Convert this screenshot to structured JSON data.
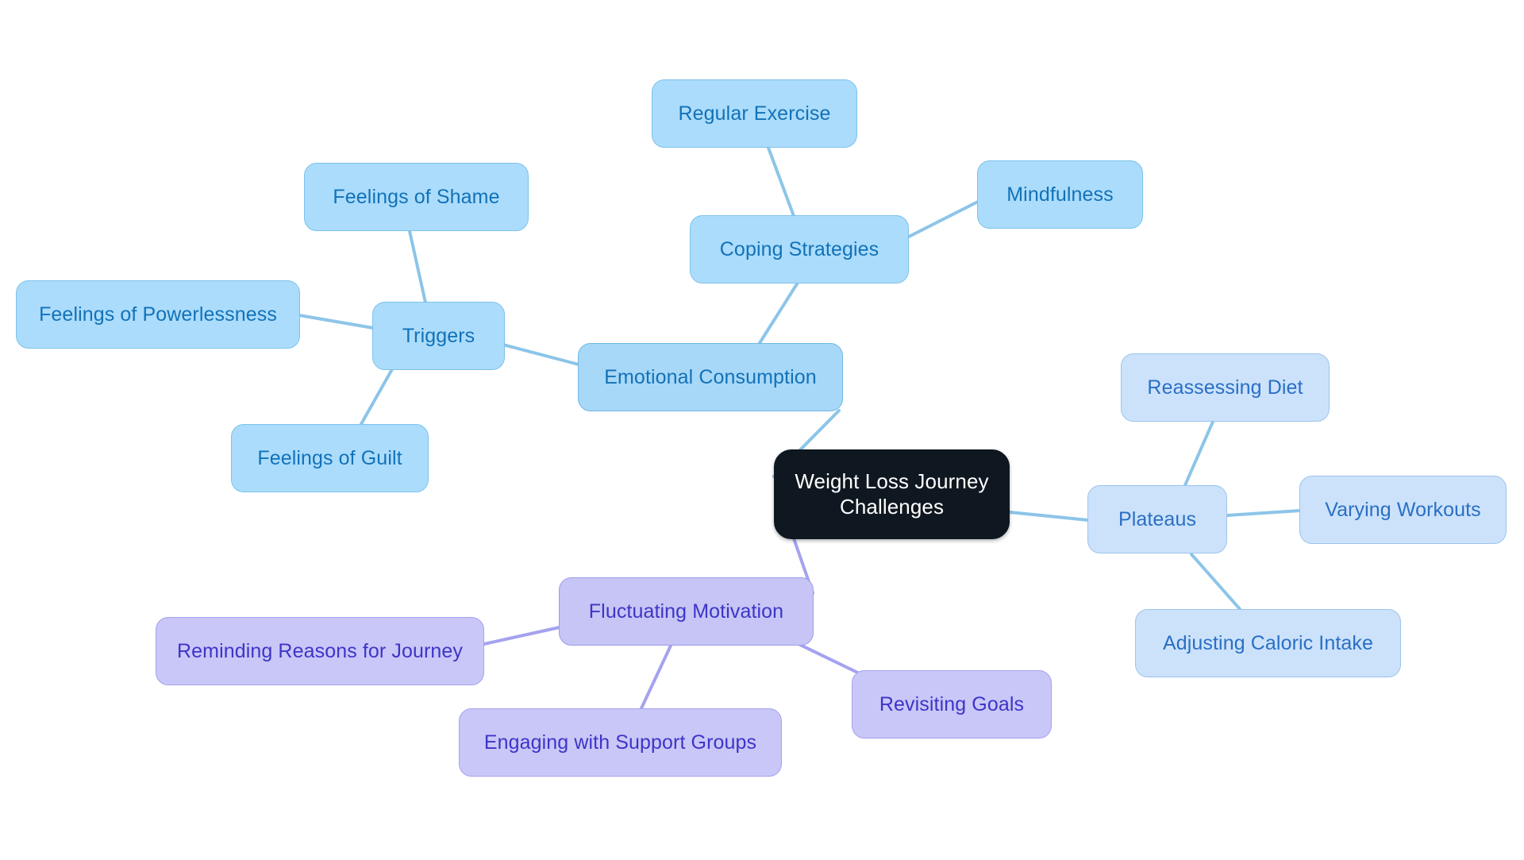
{
  "diagram": {
    "title": "Weight Loss Journey Challenges",
    "type": "mind-map",
    "background_color": "#ffffff",
    "edge_colors": {
      "blue": "#8cc5e8",
      "purple": "#a5a2ef"
    }
  },
  "nodes": {
    "root": {
      "label": "Weight Loss Journey\nChallenges"
    },
    "emotional_consumption": {
      "label": "Emotional Consumption"
    },
    "triggers": {
      "label": "Triggers"
    },
    "feelings_of_shame": {
      "label": "Feelings of Shame"
    },
    "feelings_of_powerlessness": {
      "label": "Feelings of Powerlessness"
    },
    "feelings_of_guilt": {
      "label": "Feelings of Guilt"
    },
    "coping_strategies": {
      "label": "Coping Strategies"
    },
    "regular_exercise": {
      "label": "Regular Exercise"
    },
    "mindfulness": {
      "label": "Mindfulness"
    },
    "plateaus": {
      "label": "Plateaus"
    },
    "reassessing_diet": {
      "label": "Reassessing Diet"
    },
    "varying_workouts": {
      "label": "Varying Workouts"
    },
    "adjusting_caloric_intake": {
      "label": "Adjusting Caloric Intake"
    },
    "fluctuating_motivation": {
      "label": "Fluctuating Motivation"
    },
    "reminding_reasons_for_journey": {
      "label": "Reminding Reasons for Journey"
    },
    "engaging_with_support_groups": {
      "label": "Engaging with Support Groups"
    },
    "revisiting_goals": {
      "label": "Revisiting Goals"
    }
  },
  "chart_data": {
    "type": "diagram",
    "title": "Weight Loss Journey Challenges",
    "root": "Weight Loss Journey Challenges",
    "branches": [
      {
        "name": "Emotional Consumption",
        "color": "#a8d8f8",
        "children": [
          {
            "name": "Triggers",
            "children": [
              {
                "name": "Feelings of Shame"
              },
              {
                "name": "Feelings of Powerlessness"
              },
              {
                "name": "Feelings of Guilt"
              }
            ]
          },
          {
            "name": "Coping Strategies",
            "children": [
              {
                "name": "Regular Exercise"
              },
              {
                "name": "Mindfulness"
              }
            ]
          }
        ]
      },
      {
        "name": "Plateaus",
        "color": "#cce2fb",
        "children": [
          {
            "name": "Reassessing Diet"
          },
          {
            "name": "Varying Workouts"
          },
          {
            "name": "Adjusting Caloric Intake"
          }
        ]
      },
      {
        "name": "Fluctuating Motivation",
        "color": "#c6c5f5",
        "children": [
          {
            "name": "Reminding Reasons for Journey"
          },
          {
            "name": "Engaging with Support Groups"
          },
          {
            "name": "Revisiting Goals"
          }
        ]
      }
    ],
    "edges": [
      [
        "Weight Loss Journey Challenges",
        "Emotional Consumption"
      ],
      [
        "Weight Loss Journey Challenges",
        "Plateaus"
      ],
      [
        "Weight Loss Journey Challenges",
        "Fluctuating Motivation"
      ],
      [
        "Emotional Consumption",
        "Triggers"
      ],
      [
        "Emotional Consumption",
        "Coping Strategies"
      ],
      [
        "Triggers",
        "Feelings of Shame"
      ],
      [
        "Triggers",
        "Feelings of Powerlessness"
      ],
      [
        "Triggers",
        "Feelings of Guilt"
      ],
      [
        "Coping Strategies",
        "Regular Exercise"
      ],
      [
        "Coping Strategies",
        "Mindfulness"
      ],
      [
        "Plateaus",
        "Reassessing Diet"
      ],
      [
        "Plateaus",
        "Varying Workouts"
      ],
      [
        "Plateaus",
        "Adjusting Caloric Intake"
      ],
      [
        "Fluctuating Motivation",
        "Reminding Reasons for Journey"
      ],
      [
        "Fluctuating Motivation",
        "Engaging with Support Groups"
      ],
      [
        "Fluctuating Motivation",
        "Revisiting Goals"
      ]
    ]
  }
}
